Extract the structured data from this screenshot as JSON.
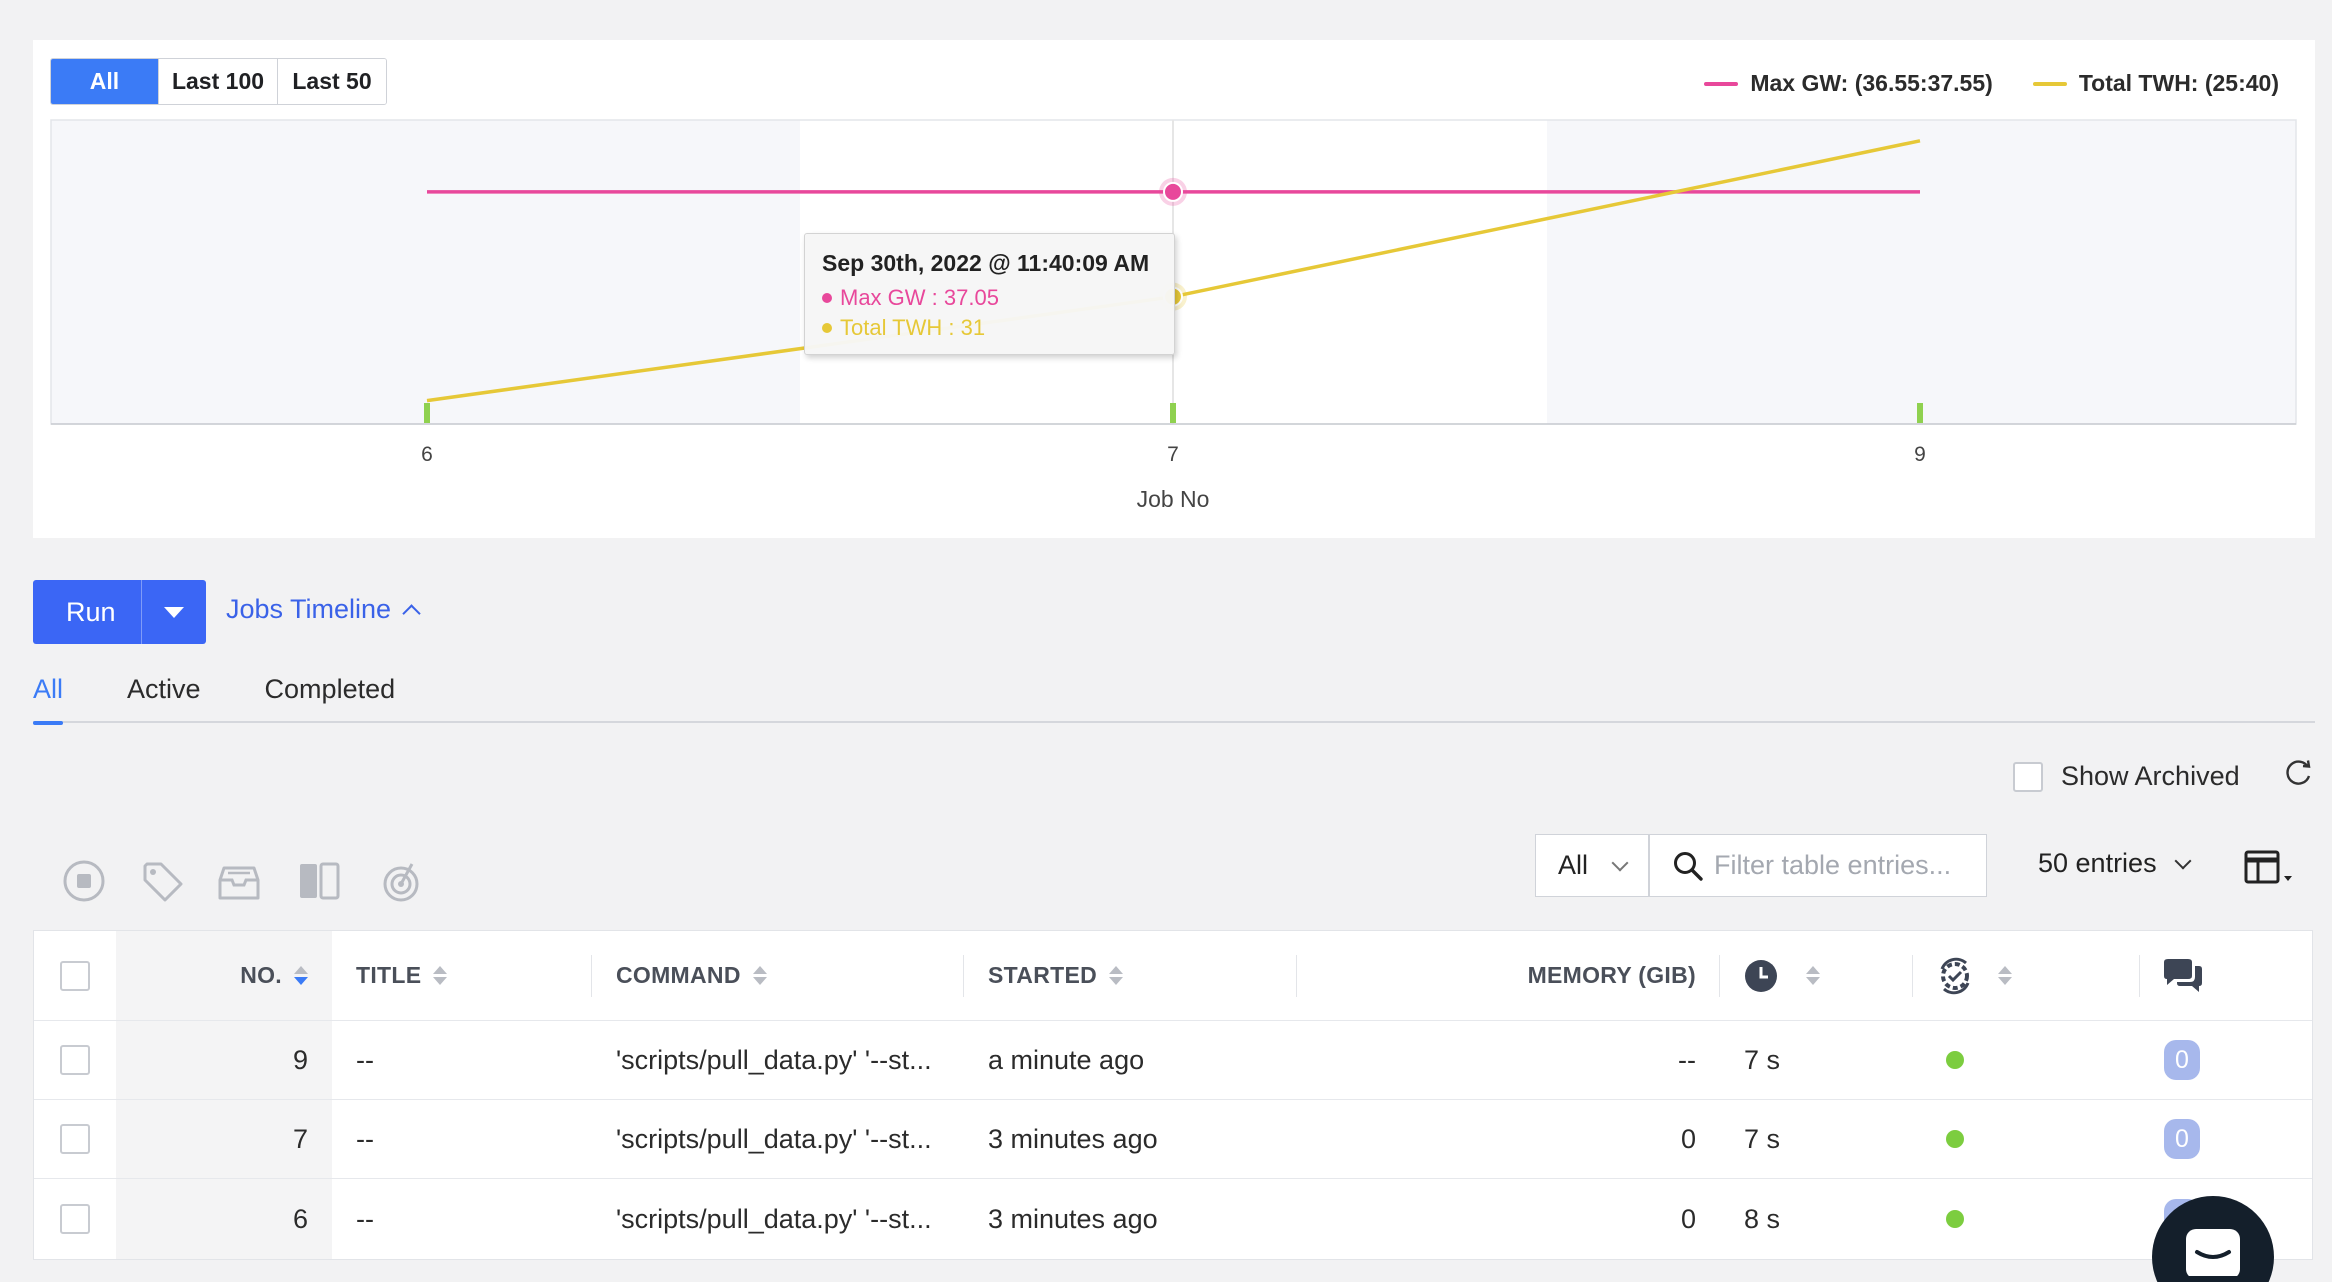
{
  "chart_range": {
    "options": [
      "All",
      "Last 100",
      "Last 50"
    ],
    "active": "All"
  },
  "chart_data": {
    "type": "line",
    "x": [
      6,
      7,
      9
    ],
    "xlabel": "Job No",
    "x_tick_labels": [
      "6",
      "7",
      "9"
    ],
    "series": [
      {
        "name": "Max GW: (36.55:37.55)",
        "color": "#e8489b",
        "values": [
          37.05,
          37.05,
          37.05
        ]
      },
      {
        "name": "Total TWH: (25:40)",
        "color": "#e6c837",
        "values": [
          25,
          31,
          40
        ]
      }
    ],
    "grid": true,
    "legend_position": "top-right"
  },
  "tooltip": {
    "title": "Sep 30th, 2022 @ 11:40:09 AM",
    "rows": [
      {
        "label": "Max GW : 37.05",
        "color": "#e8489b"
      },
      {
        "label": "Total TWH : 31",
        "color": "#e6c837"
      }
    ]
  },
  "run_button": {
    "label": "Run"
  },
  "timeline_toggle": {
    "label": "Jobs Timeline"
  },
  "tabs": [
    {
      "label": "All",
      "active": true
    },
    {
      "label": "Active",
      "active": false
    },
    {
      "label": "Completed",
      "active": false
    }
  ],
  "show_archived": {
    "label": "Show Archived",
    "checked": false
  },
  "toolbar": {
    "icons": [
      "abort-icon",
      "tag-icon",
      "archive-icon",
      "compare-icon",
      "dequeue-icon"
    ],
    "status_filter": "All",
    "search_placeholder": "Filter table entries...",
    "entries_label": "50 entries"
  },
  "table": {
    "headers": {
      "no": "NO.",
      "title": "TITLE",
      "command": "COMMAND",
      "started": "STARTED",
      "memory": "MEMORY (GIB)"
    },
    "rows": [
      {
        "no": "9",
        "title": "--",
        "command": "'scripts/pull_data.py' '--st...",
        "started": "a minute ago",
        "memory": "--",
        "duration": "7 s",
        "comments": "0"
      },
      {
        "no": "7",
        "title": "--",
        "command": "'scripts/pull_data.py' '--st...",
        "started": "3 minutes ago",
        "memory": "0",
        "duration": "7 s",
        "comments": "0"
      },
      {
        "no": "6",
        "title": "--",
        "command": "'scripts/pull_data.py' '--st...",
        "started": "3 minutes ago",
        "memory": "0",
        "duration": "8 s",
        "comments": "0"
      }
    ],
    "status_color": "#7ccd3f"
  },
  "colors": {
    "accent": "#3b7bf6",
    "run": "#3b66f5",
    "link": "#3a62e8"
  }
}
